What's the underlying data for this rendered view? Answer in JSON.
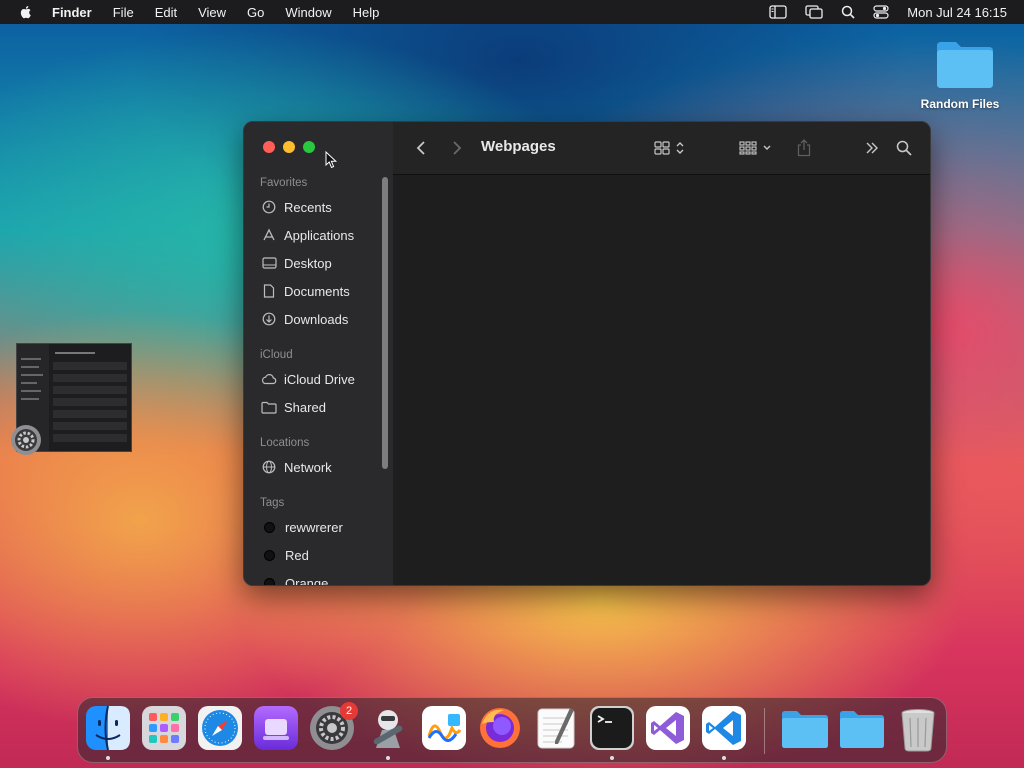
{
  "menubar": {
    "app": "Finder",
    "menus": [
      "File",
      "Edit",
      "View",
      "Go",
      "Window",
      "Help"
    ],
    "clock": "Mon Jul 24  16:15"
  },
  "desktop": {
    "folder_label": "Random Files"
  },
  "finder": {
    "title": "Webpages",
    "sidebar": {
      "favorites_header": "Favorites",
      "favorites": [
        "Recents",
        "Applications",
        "Desktop",
        "Documents",
        "Downloads"
      ],
      "icloud_header": "iCloud",
      "icloud": [
        "iCloud Drive",
        "Shared"
      ],
      "locations_header": "Locations",
      "locations": [
        "Network"
      ],
      "tags_header": "Tags",
      "tags": [
        "rewwrerer",
        "Red",
        "Orange"
      ]
    }
  },
  "dock": {
    "apps": [
      "finder-icon",
      "launchpad-icon",
      "safari-icon",
      "podcasts-icon",
      "system-settings-icon",
      "automator-icon",
      "freeform-icon",
      "firefox-icon",
      "textedit-icon",
      "terminal-icon",
      "visual-studio-icon",
      "vscode-icon"
    ],
    "settings_badge": "2",
    "colors": {
      "finder": "#1e90ff",
      "safari": "#1e88e5",
      "vscode": "#1e88e5",
      "trash": "#c9c9c9"
    }
  }
}
